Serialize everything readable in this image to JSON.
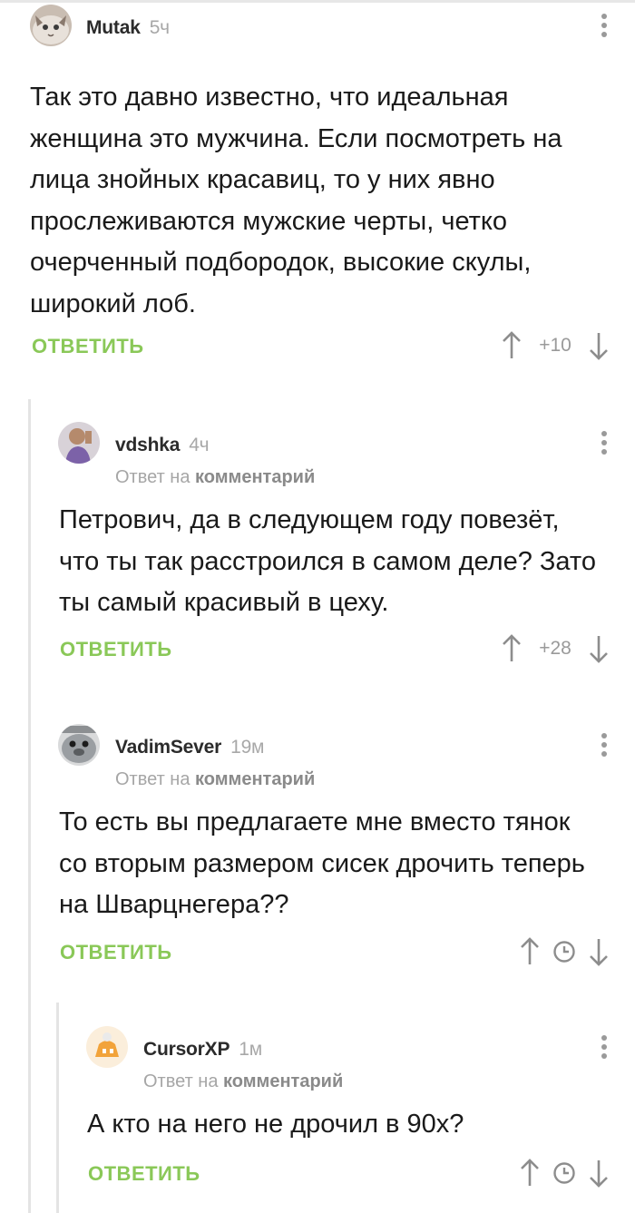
{
  "comments": [
    {
      "author": "Mutak",
      "time": "5ч",
      "text": "Так это давно известно, что идеальная женщина это мужчина. Если посмотреть на лица знойных красавиц, то у них явно прослеживаются мужские черты, четко очерченный подбородок, высокие скулы, широкий лоб.",
      "reply_label": "ОТВЕТИТЬ",
      "rating": "+10"
    },
    {
      "author": "vdshka",
      "time": "4ч",
      "reply_to_prefix": "Ответ на",
      "reply_to_link": "комментарий",
      "text": "Петрович, да в следующем году повезёт, что ты так расстроился в самом деле? Зато ты самый красивый в цеху.",
      "reply_label": "ОТВЕТИТЬ",
      "rating": "+28"
    },
    {
      "author": "VadimSever",
      "time": "19м",
      "reply_to_prefix": "Ответ на",
      "reply_to_link": "комментарий",
      "text": "То есть вы предлагаете мне вместо тянок со вторым размером сисек дрочить теперь на Шварцнегера??",
      "reply_label": "ОТВЕТИТЬ",
      "rating_icon": "clock-icon"
    },
    {
      "author": "CursorXP",
      "time": "1м",
      "reply_to_prefix": "Ответ на",
      "reply_to_link": "комментарий",
      "text": "А кто на него не дрочил в 90х?",
      "reply_label": "ОТВЕТИТЬ",
      "rating_icon": "clock-icon"
    }
  ],
  "colors": {
    "accent": "#8ac858",
    "muted": "#a6a6a6",
    "thread_line": "#e4e4e4"
  }
}
